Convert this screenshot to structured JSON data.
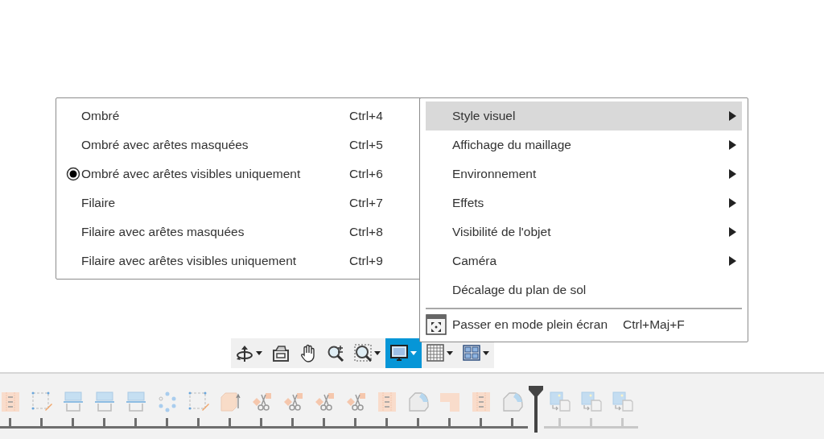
{
  "display_menu": {
    "items": [
      {
        "kind": "submenu",
        "label": "Style visuel",
        "selected": true
      },
      {
        "kind": "submenu",
        "label": "Affichage du maillage",
        "selected": false
      },
      {
        "kind": "submenu",
        "label": "Environnement",
        "selected": false
      },
      {
        "kind": "submenu",
        "label": "Effets",
        "selected": false
      },
      {
        "kind": "submenu",
        "label": "Visibilité de l'objet",
        "selected": false
      },
      {
        "kind": "submenu",
        "label": "Caméra",
        "selected": false
      },
      {
        "kind": "plain",
        "label": "Décalage du plan de sol",
        "selected": false
      },
      {
        "kind": "separator"
      },
      {
        "kind": "command",
        "label": "Passer en mode plein écran",
        "shortcut": "Ctrl+Maj+F",
        "selected": false
      }
    ]
  },
  "visual_style_menu": {
    "items": [
      {
        "label": "Ombré",
        "shortcut": "Ctrl+4",
        "selected": false
      },
      {
        "label": "Ombré avec arêtes masquées",
        "shortcut": "Ctrl+5",
        "selected": false
      },
      {
        "label": "Ombré avec arêtes visibles uniquement",
        "shortcut": "Ctrl+6",
        "selected": true
      },
      {
        "label": "Filaire",
        "shortcut": "Ctrl+7",
        "selected": false
      },
      {
        "label": "Filaire avec arêtes masquées",
        "shortcut": "Ctrl+8",
        "selected": false
      },
      {
        "label": "Filaire avec arêtes visibles uniquement",
        "shortcut": "Ctrl+9",
        "selected": false
      }
    ]
  },
  "navigation_toolbar": [
    {
      "kind": "orbit",
      "dropdown": true,
      "selected": false
    },
    {
      "kind": "look",
      "dropdown": false,
      "selected": false
    },
    {
      "kind": "pan",
      "dropdown": false,
      "selected": false
    },
    {
      "kind": "zoom",
      "dropdown": false,
      "selected": false
    },
    {
      "kind": "fit",
      "dropdown": true,
      "selected": false
    },
    {
      "kind": "display",
      "dropdown": true,
      "selected": true
    },
    {
      "kind": "grid",
      "dropdown": true,
      "selected": false
    },
    {
      "kind": "viewports",
      "dropdown": true,
      "selected": false
    }
  ],
  "timeline": {
    "features": [
      {
        "kind": "panel",
        "rolled_back": false
      },
      {
        "kind": "sketch",
        "rolled_back": false
      },
      {
        "kind": "plane",
        "rolled_back": false
      },
      {
        "kind": "plane",
        "rolled_back": false
      },
      {
        "kind": "plane",
        "rolled_back": false
      },
      {
        "kind": "pattern",
        "rolled_back": false
      },
      {
        "kind": "sketch",
        "rolled_back": false
      },
      {
        "kind": "extrude",
        "rolled_back": false
      },
      {
        "kind": "split",
        "rolled_back": false
      },
      {
        "kind": "split",
        "rolled_back": false
      },
      {
        "kind": "split",
        "rolled_back": false
      },
      {
        "kind": "split",
        "rolled_back": false
      },
      {
        "kind": "panel",
        "rolled_back": false
      },
      {
        "kind": "fillet",
        "rolled_back": false
      },
      {
        "kind": "flange",
        "rolled_back": false
      },
      {
        "kind": "panel",
        "rolled_back": false
      },
      {
        "kind": "fillet",
        "rolled_back": false
      },
      {
        "kind": "image",
        "rolled_back": true
      },
      {
        "kind": "image",
        "rolled_back": true
      },
      {
        "kind": "image",
        "rolled_back": true
      }
    ]
  }
}
